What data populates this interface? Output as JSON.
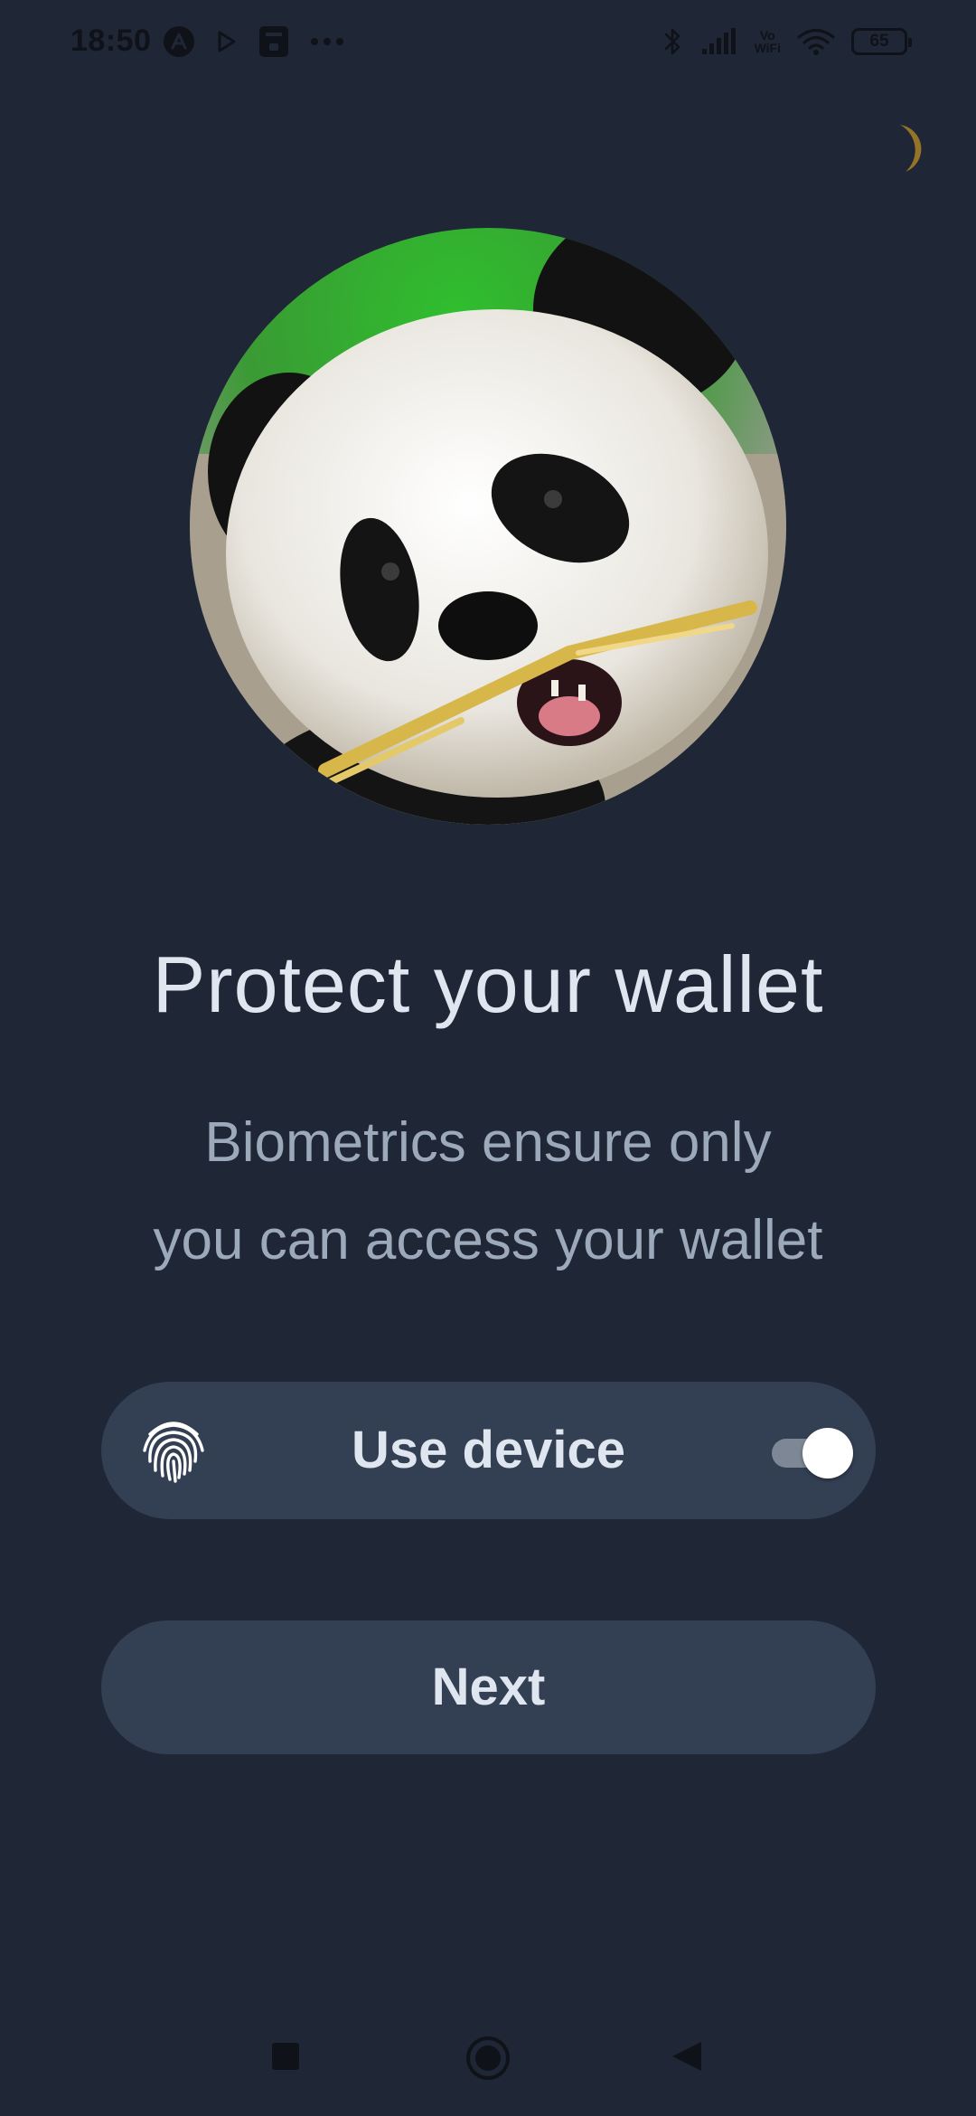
{
  "status_bar": {
    "time": "18:50",
    "battery": "65",
    "vowifi_top": "Vo",
    "vowifi_bottom": "WiFi",
    "icons": [
      "a-app-icon",
      "play-icon",
      "notification-app-icon",
      "more-dots-icon",
      "bluetooth-icon",
      "signal-icon",
      "vowifi-icon",
      "wifi-icon",
      "battery-icon"
    ]
  },
  "theme_toggle": {
    "icon": "moon-icon",
    "color": "#f4c531"
  },
  "avatar": {
    "subject": "panda-image"
  },
  "content": {
    "title": "Protect your wallet",
    "subtitle_line1": "Biometrics ensure only",
    "subtitle_line2": "you can access your wallet"
  },
  "biometric": {
    "icon": "fingerprint-icon",
    "label": "Use device",
    "enabled": true
  },
  "actions": {
    "next_label": "Next"
  },
  "nav_bar": {
    "buttons": [
      "recents-square-icon",
      "home-circle-icon",
      "back-triangle-icon"
    ]
  },
  "colors": {
    "background": "#1f2636",
    "card": "#334053",
    "title_text": "#dfe6ef",
    "subtitle_text": "#9ca9bb"
  }
}
